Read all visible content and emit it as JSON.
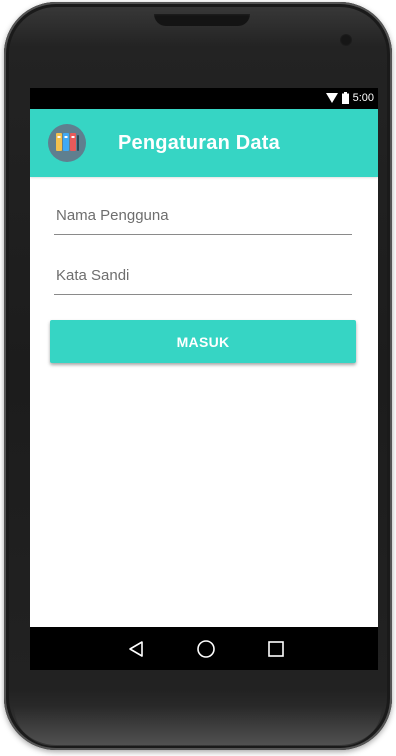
{
  "status_bar": {
    "time": "5:00",
    "icons": [
      "wifi-icon",
      "battery-icon"
    ]
  },
  "app_bar": {
    "title": "Pengaturan Data",
    "icon": "binders-icon",
    "color": "#36d5c4"
  },
  "form": {
    "username_placeholder": "Nama Pengguna",
    "password_placeholder": "Kata Sandi",
    "login_label": "MASUK"
  },
  "nav_bar": {
    "icons": [
      "back-icon",
      "home-icon",
      "recents-icon"
    ]
  }
}
